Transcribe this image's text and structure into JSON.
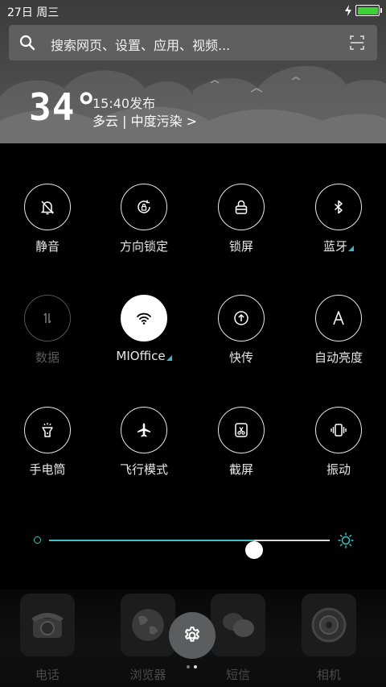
{
  "status_bar": {
    "date": "27日  周三",
    "battery_level": 1.0,
    "charging": true,
    "battery_color": "#3ed135"
  },
  "search": {
    "placeholder": "搜索网页、设置、应用、视频..."
  },
  "weather": {
    "temperature": "34°",
    "publish_time": "15:40发布",
    "description": "多云 | 中度污染 >"
  },
  "toggles": [
    {
      "label": "静音",
      "icon": "bell-off-icon",
      "state": "off"
    },
    {
      "label": "方向锁定",
      "icon": "rotation-lock-icon",
      "state": "off"
    },
    {
      "label": "锁屏",
      "icon": "lock-icon",
      "state": "off"
    },
    {
      "label": "蓝牙",
      "icon": "bluetooth-icon",
      "state": "off",
      "has_more": true
    },
    {
      "label": "数据",
      "icon": "data-arrows-icon",
      "state": "disabled"
    },
    {
      "label": "MIOffice",
      "icon": "wifi-icon",
      "state": "on",
      "has_more": true
    },
    {
      "label": "快传",
      "icon": "upload-icon",
      "state": "off"
    },
    {
      "label": "自动亮度",
      "icon": "auto-brightness-icon",
      "state": "off"
    },
    {
      "label": "手电筒",
      "icon": "flashlight-icon",
      "state": "off"
    },
    {
      "label": "飞行模式",
      "icon": "airplane-icon",
      "state": "off"
    },
    {
      "label": "截屏",
      "icon": "screenshot-icon",
      "state": "off"
    },
    {
      "label": "振动",
      "icon": "vibrate-icon",
      "state": "off"
    }
  ],
  "brightness": {
    "level": 0.73,
    "accent": "#3ec3c0"
  },
  "dock": {
    "apps": [
      {
        "label": "电话",
        "icon": "phone-icon"
      },
      {
        "label": "浏览器",
        "icon": "globe-icon"
      },
      {
        "label": "短信",
        "icon": "chat-icon"
      },
      {
        "label": "相机",
        "icon": "camera-icon"
      }
    ],
    "page_count": 2,
    "current_page": 2
  },
  "settings_fab": {
    "icon": "gear-icon"
  }
}
